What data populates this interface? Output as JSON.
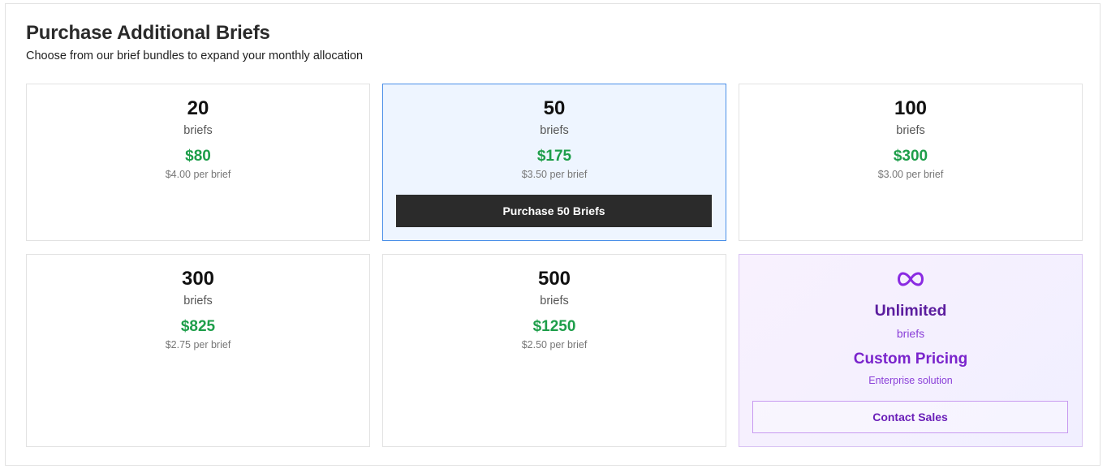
{
  "header": {
    "title": "Purchase Additional Briefs",
    "subtitle": "Choose from our brief bundles to expand your monthly allocation"
  },
  "bundles": [
    {
      "quantity": "20",
      "unit": "briefs",
      "price": "$80",
      "per_brief": "$4.00 per brief"
    },
    {
      "quantity": "50",
      "unit": "briefs",
      "price": "$175",
      "per_brief": "$3.50 per brief",
      "selected": true,
      "button_label": "Purchase 50 Briefs"
    },
    {
      "quantity": "100",
      "unit": "briefs",
      "price": "$300",
      "per_brief": "$3.00 per brief"
    },
    {
      "quantity": "300",
      "unit": "briefs",
      "price": "$825",
      "per_brief": "$2.75 per brief"
    },
    {
      "quantity": "500",
      "unit": "briefs",
      "price": "$1250",
      "per_brief": "$2.50 per brief"
    }
  ],
  "enterprise": {
    "icon": "infinity-icon",
    "title": "Unlimited",
    "unit": "briefs",
    "price": "Custom Pricing",
    "subtitle": "Enterprise solution",
    "button_label": "Contact Sales"
  },
  "colors": {
    "price_green": "#1e9e4a",
    "selected_border": "#4a8fe8",
    "selected_bg": "#eef5ff",
    "primary_button": "#2b2b2b",
    "enterprise_purple": "#7a24cc"
  }
}
